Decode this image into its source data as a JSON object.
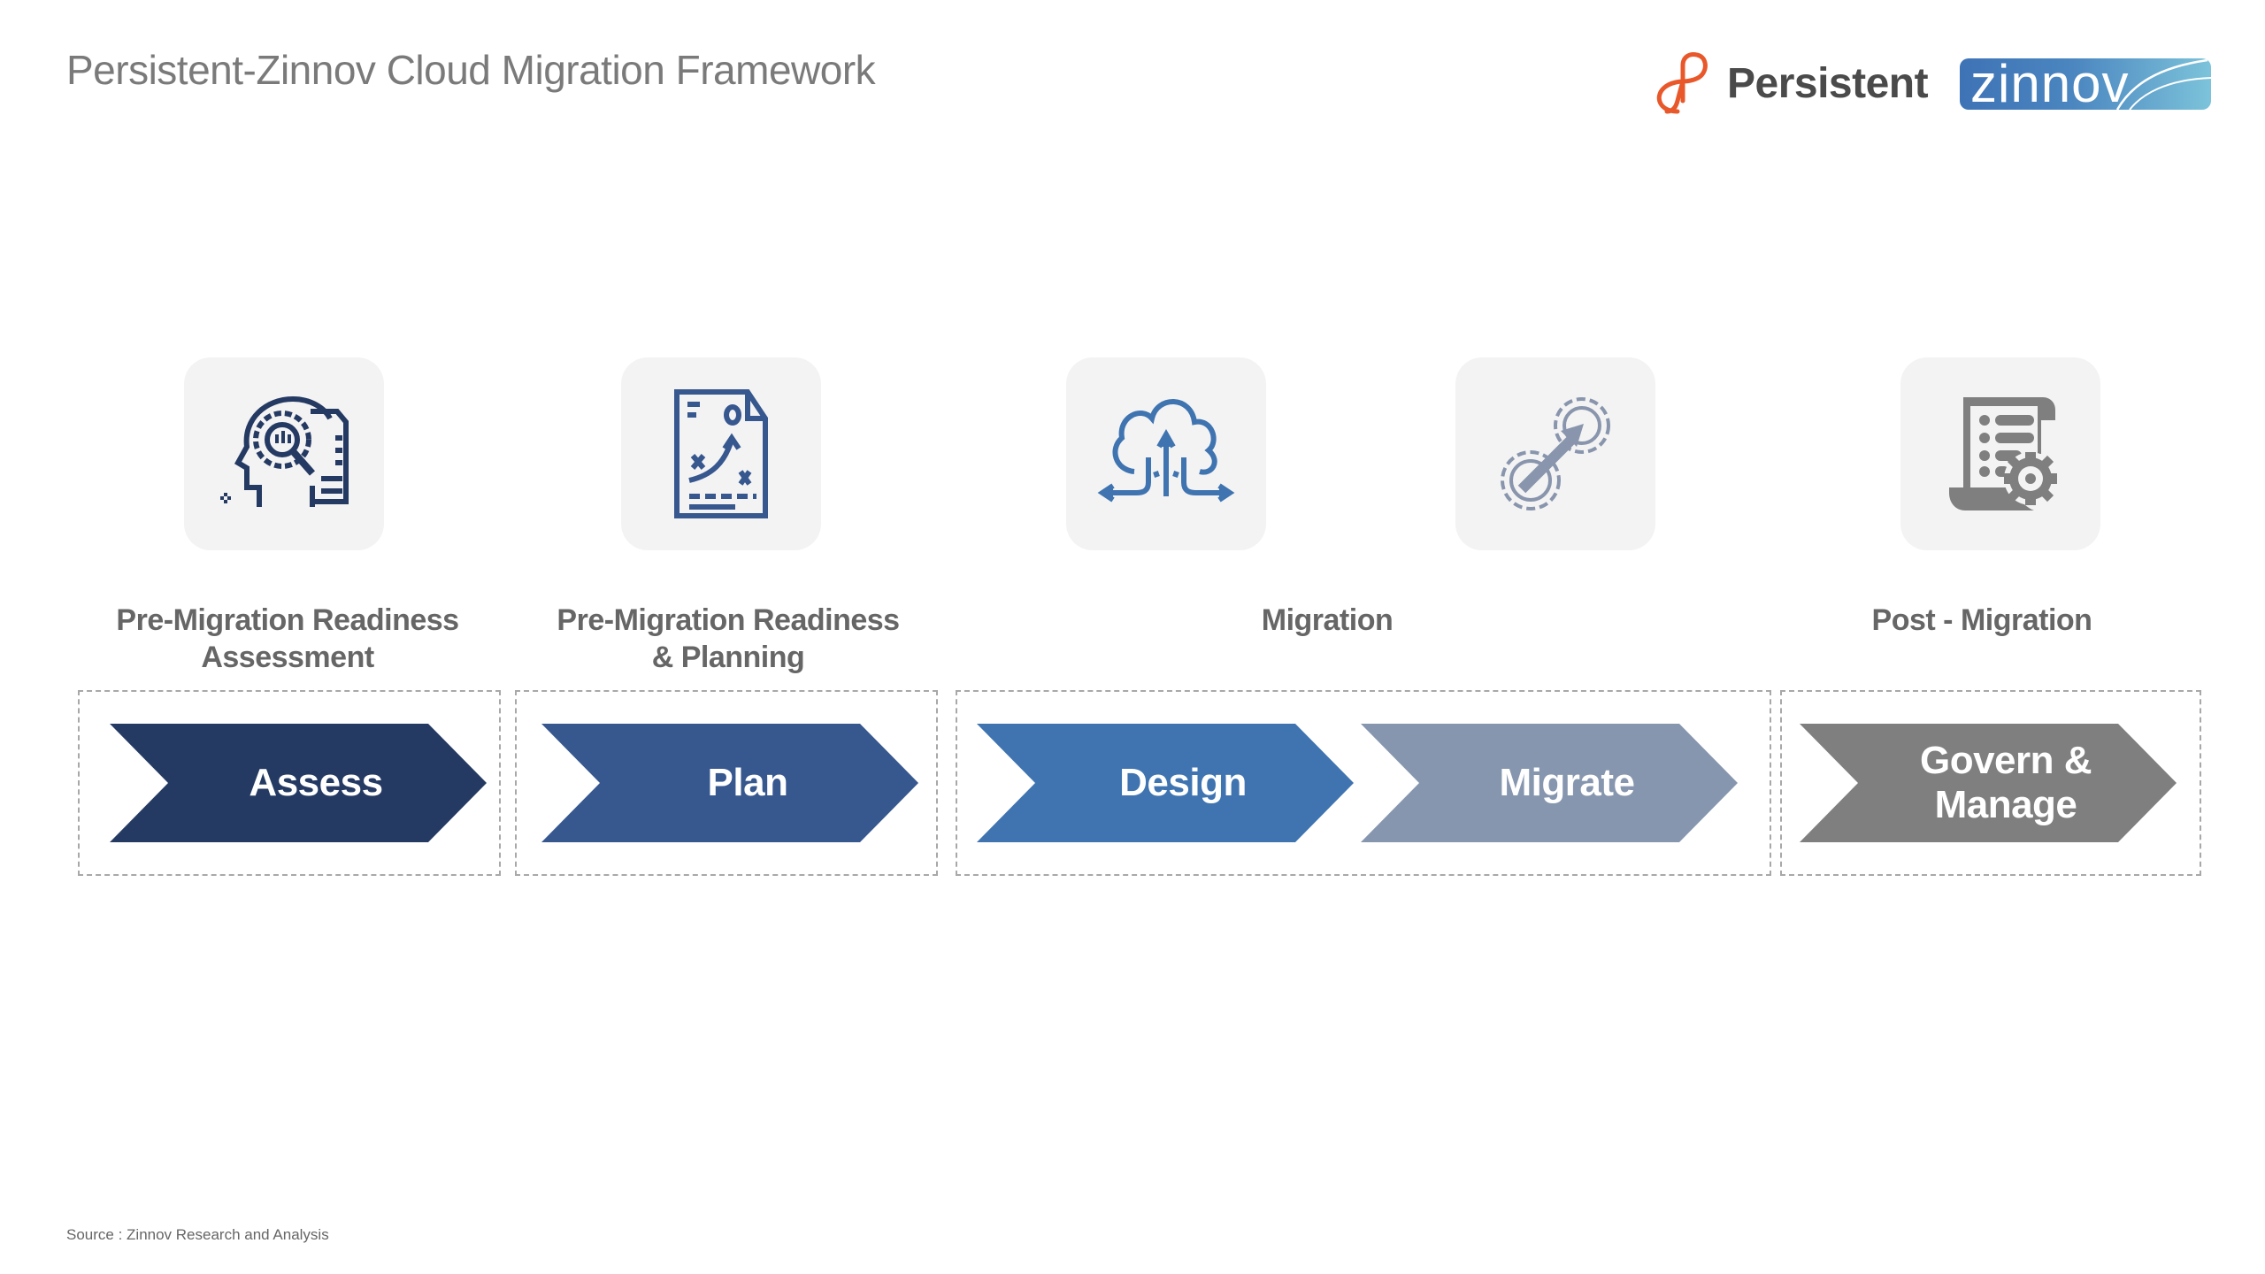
{
  "title": "Persistent-Zinnov Cloud Migration Framework",
  "logos": {
    "persistent": {
      "text": "Persistent",
      "color": "#e8582b",
      "icon": "persistent-infinity-icon"
    },
    "zinnov": {
      "text": "zinnov",
      "icon": "zinnov-swoosh-icon"
    }
  },
  "icons": [
    {
      "name": "head-analysis-icon",
      "color": "#253a63"
    },
    {
      "name": "strategy-plan-document-icon",
      "color": "#37578f"
    },
    {
      "name": "cloud-migration-arrows-icon",
      "color": "#3f74b1"
    },
    {
      "name": "gears-arrow-icon",
      "color": "#8895ad"
    },
    {
      "name": "document-settings-icon",
      "color": "#7f7f7f"
    }
  ],
  "phases": [
    {
      "label_line1": "Pre-Migration Readiness",
      "label_line2": "Assessment"
    },
    {
      "label_line1": "Pre-Migration Readiness",
      "label_line2": "& Planning"
    },
    {
      "label_line1": "Migration",
      "label_line2": ""
    },
    {
      "label_line1": "Post - Migration",
      "label_line2": ""
    }
  ],
  "steps": [
    {
      "label": "Assess",
      "color": "#253a63"
    },
    {
      "label": "Plan",
      "color": "#37578f"
    },
    {
      "label": "Design",
      "color": "#3f74b1"
    },
    {
      "label": "Migrate",
      "color": "#8696ae"
    },
    {
      "label_line1": "Govern &",
      "label_line2": "Manage",
      "color": "#7f7f7f"
    }
  ],
  "source": "Source : Zinnov Research and Analysis"
}
